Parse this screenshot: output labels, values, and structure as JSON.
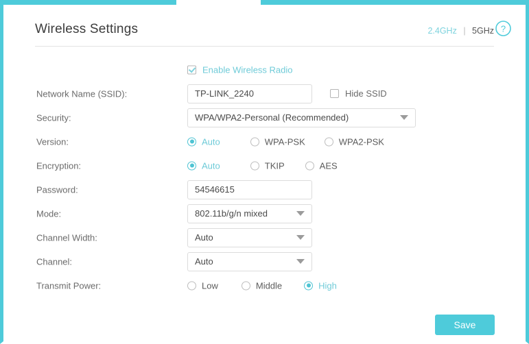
{
  "theme": {
    "accent": "#4ecbda",
    "accent_text": "#6fcbd8",
    "label_text": "#6b6b6b",
    "value_text": "#4a4a4a",
    "border": "#dcdcdc"
  },
  "header": {
    "title": "Wireless Settings",
    "bands": [
      {
        "label": "2.4GHz",
        "active": true
      },
      {
        "label": "5GHz",
        "active": false
      }
    ],
    "band_separator": "|",
    "help_icon": "help-circle-icon"
  },
  "form": {
    "enable_radio": {
      "label": "Enable Wireless Radio",
      "checked": true
    },
    "ssid": {
      "label": "Network Name (SSID):",
      "value": "TP-LINK_2240",
      "placeholder": "",
      "hide_ssid": {
        "label": "Hide SSID",
        "checked": false
      }
    },
    "security": {
      "label": "Security:",
      "value": "WPA/WPA2-Personal (Recommended)",
      "icon": "chevron-down-icon"
    },
    "version": {
      "label": "Version:",
      "options": [
        {
          "label": "Auto",
          "selected": true
        },
        {
          "label": "WPA-PSK",
          "selected": false
        },
        {
          "label": "WPA2-PSK",
          "selected": false
        }
      ]
    },
    "encryption": {
      "label": "Encryption:",
      "options": [
        {
          "label": "Auto",
          "selected": true
        },
        {
          "label": "TKIP",
          "selected": false
        },
        {
          "label": "AES",
          "selected": false
        }
      ]
    },
    "password": {
      "label": "Password:",
      "value": "54546615",
      "placeholder": ""
    },
    "mode": {
      "label": "Mode:",
      "value": "802.11b/g/n mixed",
      "icon": "chevron-down-icon"
    },
    "channel_width": {
      "label": "Channel Width:",
      "value": "Auto",
      "icon": "chevron-down-icon"
    },
    "channel": {
      "label": "Channel:",
      "value": "Auto",
      "icon": "chevron-down-icon"
    },
    "transmit_power": {
      "label": "Transmit Power:",
      "options": [
        {
          "label": "Low",
          "selected": false
        },
        {
          "label": "Middle",
          "selected": false
        },
        {
          "label": "High",
          "selected": true
        }
      ]
    }
  },
  "footer": {
    "save_label": "Save"
  }
}
